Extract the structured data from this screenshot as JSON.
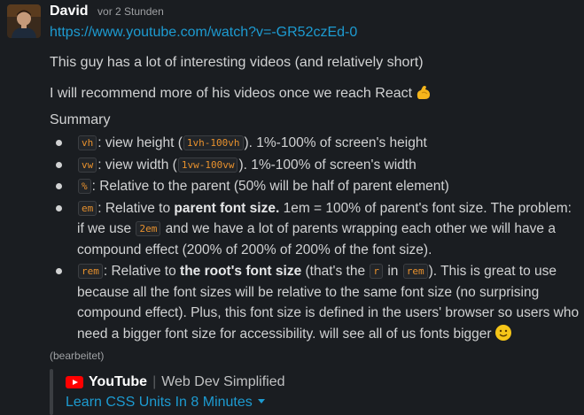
{
  "message": {
    "author": "David",
    "timestamp": "vor 2 Stunden",
    "link": "https://www.youtube.com/watch?v=-GR52czEd-0",
    "line1": "This guy has a lot of interesting videos (and relatively short)",
    "line2": "I will recommend more of his videos once we reach React",
    "summary_heading": "Summary",
    "items": [
      {
        "code": "vh",
        "t1": ": view height (",
        "code2": "1vh-100vh",
        "t2": "). 1%-100% of screen's height"
      },
      {
        "code": "vw",
        "t1": ": view width (",
        "code2": "1vw-100vw",
        "t2": "). 1%-100% of screen's width"
      },
      {
        "code": "%",
        "t1": ": Relative to the parent (50% will be half of parent element)"
      },
      {
        "code": "em",
        "t1": ": Relative to ",
        "bold": "parent font size.",
        "t2": " 1em = 100% of parent's font size. The problem: if we use ",
        "code2": "2em",
        "t3": " and we have a lot of parents wrapping each other we will have a compound effect (200% of 200% of 200% of the font size)."
      },
      {
        "code": "rem",
        "t1": ": Relative to ",
        "bold": "the root's font size",
        "t2": "  (that's the ",
        "code2": "r",
        "t3": " in ",
        "code3": "rem",
        "t4": "). This is great to use because all the font sizes will be relative to the same font size (no surprising compound effect). Plus, this font size is defined in the users' browser so users who need a bigger font size for accessibility. will see all of us fonts bigger"
      }
    ],
    "edited": "(bearbeitet)"
  },
  "attachment": {
    "service": "YouTube",
    "channel": "Web Dev Simplified",
    "title": "Learn CSS Units In 8 Minutes",
    "brand_color": "#ff0000"
  },
  "colors": {
    "link": "#1d9bd1",
    "code": "#e8912d",
    "background": "#1a1d21"
  }
}
